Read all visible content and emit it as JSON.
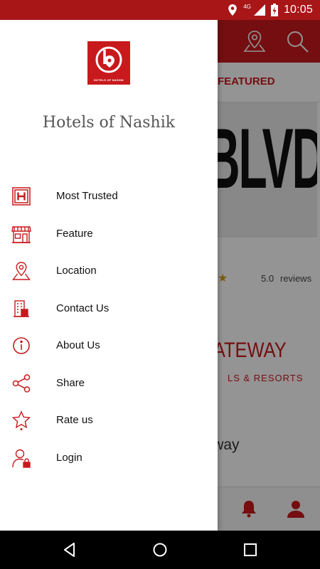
{
  "status_bar": {
    "network_label": "4G",
    "time": "10:05",
    "icons": [
      "location-icon",
      "signal-icon",
      "battery-charging-icon"
    ],
    "background": "#a81618"
  },
  "app": {
    "toolbar_icons": [
      "map-pin-icon",
      "search-icon"
    ],
    "tab_featured": "FEATURED",
    "card1": {
      "image_text": "BLVD",
      "rating_value": "5.0",
      "rating_label": "reviews"
    },
    "card2": {
      "image_text": "GATEWAY",
      "image_subtext": "LS & RESORTS",
      "title": "ateway"
    },
    "bottom_nav_icons": [
      "bell-icon",
      "user-icon"
    ]
  },
  "drawer": {
    "logo_caption": "HOTELS OF NASHIK",
    "title": "Hotels of Nashik",
    "menu": [
      {
        "label": "Most Trusted",
        "icon": "hotel-h-icon"
      },
      {
        "label": "Feature",
        "icon": "storefront-icon"
      },
      {
        "label": "Location",
        "icon": "map-pin-icon"
      },
      {
        "label": "Contact Us",
        "icon": "building-contact-icon"
      },
      {
        "label": "About Us",
        "icon": "info-icon"
      },
      {
        "label": "Share",
        "icon": "share-icon"
      },
      {
        "label": "Rate us",
        "icon": "star-icon"
      },
      {
        "label": "Login",
        "icon": "user-lock-icon"
      }
    ]
  },
  "nav_bar": {
    "buttons": [
      "back-icon",
      "home-icon",
      "recents-icon"
    ]
  },
  "colors": {
    "brand_red": "#c8191c",
    "status_red": "#a81618",
    "star_gold": "#d4a017"
  }
}
